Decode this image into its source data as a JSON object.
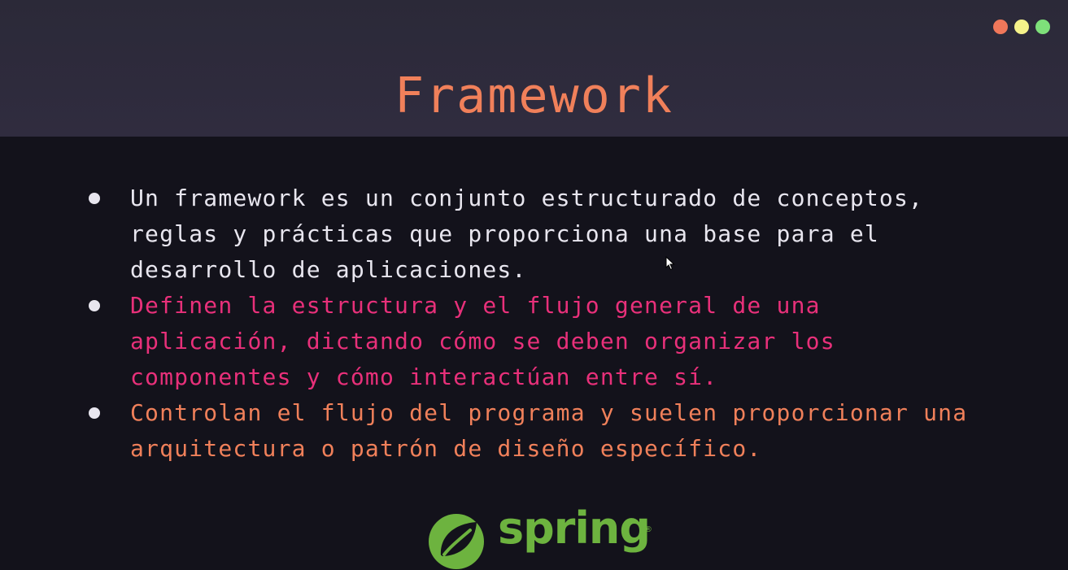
{
  "slide": {
    "title": "Framework",
    "bullets": [
      {
        "text": "Un framework es un conjunto estructurado de conceptos, reglas y prácticas que proporciona una base para el desarrollo de aplicaciones.",
        "color": "#e8e6ef"
      },
      {
        "text": "Definen la estructura y el flujo general de una aplicación, dictando cómo se deben organizar los componentes y cómo interactúan entre sí.",
        "color": "#e8307a"
      },
      {
        "text": "Controlan el flujo del programa y suelen proporcionar una arquitectura o patrón de diseño específico.",
        "color": "#f0805a"
      }
    ]
  },
  "logo": {
    "wordmark": "spring",
    "registered": "®",
    "icon": "spring-leaf-icon",
    "color": "#6db33f"
  },
  "window_controls": [
    {
      "name": "close-dot",
      "color": "#f0775a"
    },
    {
      "name": "minimize-dot",
      "color": "#f5f28a"
    },
    {
      "name": "maximize-dot",
      "color": "#7ee07a"
    }
  ],
  "colors": {
    "title": "#f0805a",
    "header_bg": "#2e2b3c",
    "body_bg": "#13121b"
  }
}
